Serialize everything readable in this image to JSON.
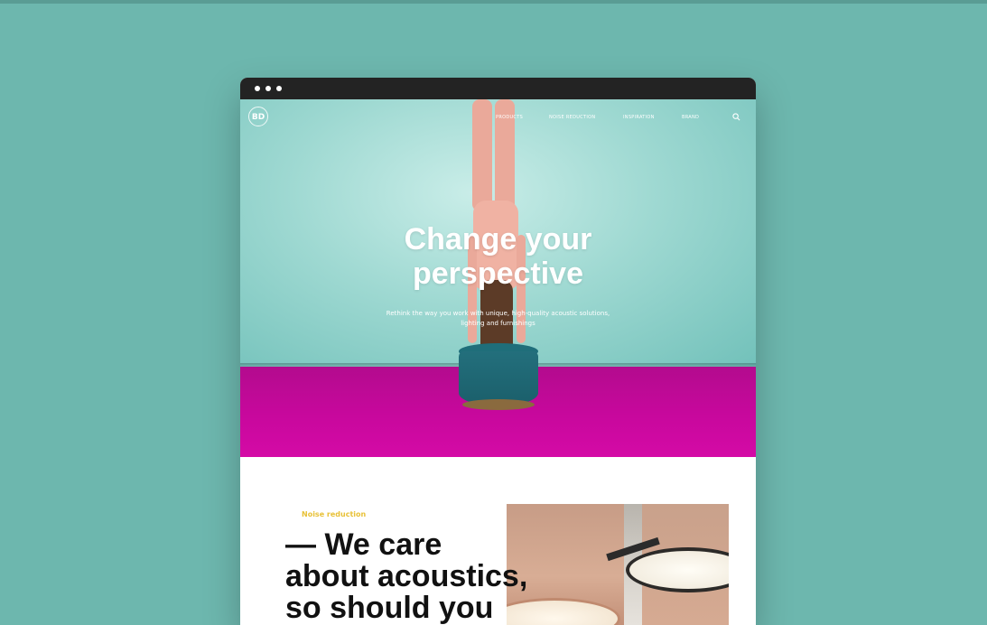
{
  "nav": {
    "logo_text": "BD",
    "items": [
      "PRODUCTS",
      "NOISE REDUCTION",
      "INSPIRATION",
      "BRAND"
    ],
    "search_icon": "search-icon"
  },
  "hero": {
    "title_line1": "Change your",
    "title_line2": "perspective",
    "subtitle": "Rethink the way you work with unique, high-quality acoustic solutions, lighting and furnishings"
  },
  "section": {
    "eyebrow": "Noise reduction",
    "heading_line1": "— We care",
    "heading_line2": "about acoustics,",
    "heading_line3": "so should you"
  },
  "colors": {
    "background": "#6db7ae",
    "wall": "#9fd9d2",
    "floor": "#c8089d",
    "accent": "#e8c137",
    "chrome": "#232323"
  }
}
